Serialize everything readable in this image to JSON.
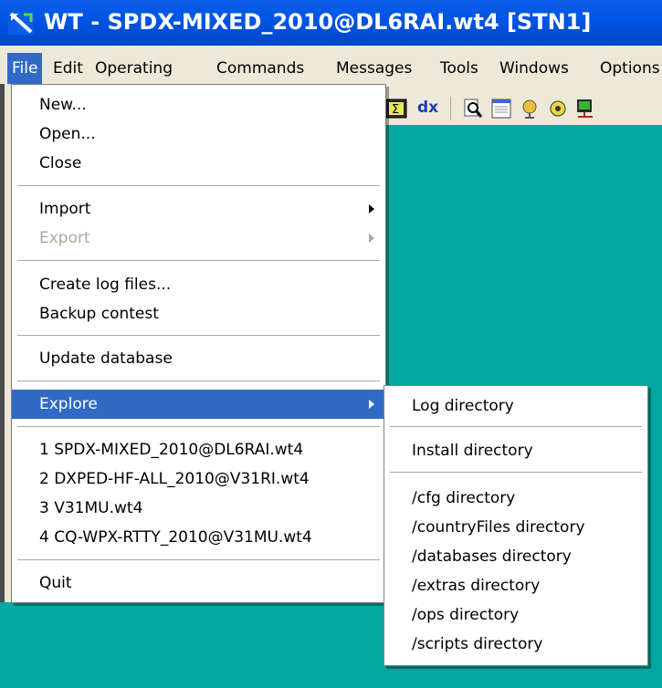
{
  "window": {
    "title": "WT - SPDX-MIXED_2010@DL6RAI.wt4 [STN1]"
  },
  "menubar": {
    "items": [
      {
        "label": "File"
      },
      {
        "label": "Edit"
      },
      {
        "label": "Operating"
      },
      {
        "label": "Commands"
      },
      {
        "label": "Messages"
      },
      {
        "label": "Tools"
      },
      {
        "label": "Windows"
      },
      {
        "label": "Options"
      }
    ]
  },
  "toolbar": {
    "dx_label": "dx",
    "icons": [
      "sigma-icon",
      "dx-icon",
      "zoom-icon",
      "window-icon",
      "globe-icon",
      "gear-icon",
      "network-icon"
    ]
  },
  "file_menu": {
    "items": [
      {
        "label": "New..."
      },
      {
        "label": "Open..."
      },
      {
        "label": "Close"
      },
      {
        "label": "Import"
      },
      {
        "label": "Export"
      },
      {
        "label": "Create log files..."
      },
      {
        "label": "Backup contest"
      },
      {
        "label": "Update database"
      },
      {
        "label": "Explore"
      },
      {
        "label": "1 SPDX-MIXED_2010@DL6RAI.wt4"
      },
      {
        "label": "2 DXPED-HF-ALL_2010@V31RI.wt4"
      },
      {
        "label": "3 V31MU.wt4"
      },
      {
        "label": "4 CQ-WPX-RTTY_2010@V31MU.wt4"
      },
      {
        "label": "Quit"
      }
    ]
  },
  "explore_menu": {
    "items": [
      {
        "label": "Log directory"
      },
      {
        "label": "Install directory"
      },
      {
        "label": "/cfg directory"
      },
      {
        "label": "/countryFiles directory"
      },
      {
        "label": "/databases directory"
      },
      {
        "label": "/extras directory"
      },
      {
        "label": "/ops directory"
      },
      {
        "label": "/scripts directory"
      }
    ]
  },
  "colors": {
    "titlebar": "#0055e5",
    "highlight": "#316ac5",
    "workspace": "#00a8a0",
    "menu_bg": "#ffffff"
  }
}
